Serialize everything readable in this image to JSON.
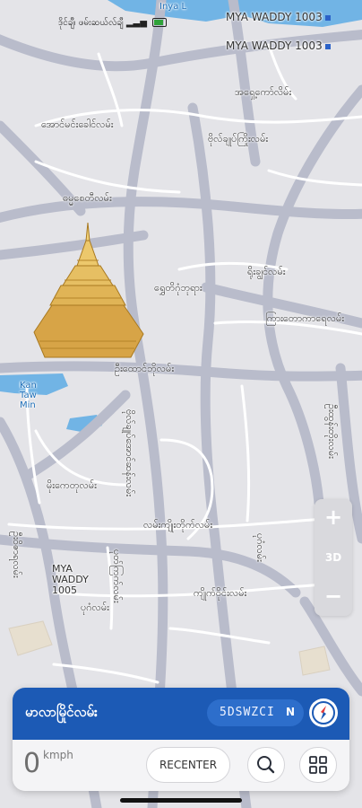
{
  "status_bar": {
    "text": "ဒိုင်ချီ၊ ဖမ်းဆယ်လ်ချီ",
    "battery_level": 0.8
  },
  "map": {
    "labels": {
      "top_water": "Inya L",
      "mya_waddy_top_a": "MYA WADDY 1003",
      "mya_waddy_top_b": "MYA WADDY 1003",
      "road_1": "အရှေ့ကော်လိမ်း",
      "road_2": "အောင်မင်းခေါင်လမ်း",
      "road_3": "ဗိုလ်ချုပ်ကြိုးလမ်း",
      "road_4": "ဓမ္မစေတီလမ်း",
      "road_5": "ရွှေတိဂုံဘုရား",
      "road_6": "ရိုးချွင်လမ်း",
      "road_7": "ကြားတောကာရေလမ်း",
      "road_8": "ဦးထောင်ဘိုလမ်း",
      "water_kan": "Kan\nTaw\nMin",
      "road_9": "မိုးကေတုလမ်း",
      "road_10": "ဗိုလ်ချုပ်အောင်ဆန်းလမ်း",
      "road_11": "ဦးထွန်းတိုးလမ်း",
      "road_12": "လမ်းကျိုးတိုက်လမ်း",
      "road_13": "ဦးဝိဇာရလမ်း",
      "road_14": "ပုတ်ကြက်လမ်း",
      "mya_waddy_mid": "MYA\nWADDY\n1005",
      "road_15": "ပုဂံလမ်း",
      "road_16": "ကျိုက်ဝိုင်းလမ်း",
      "road_17": "ပုဂံလမ်း"
    }
  },
  "map_controls": {
    "zoom_in": "+",
    "tilt": "3D",
    "zoom_out": "−"
  },
  "nav_panel": {
    "street_name": "မာလာမြိုင်လမ်း",
    "location_code": "5DSWZCI",
    "heading": "N",
    "speed_value": "0",
    "speed_unit": "kmph",
    "recenter_label": "RECENTER"
  },
  "icons": {
    "compass": "compass-icon",
    "search": "search-icon",
    "grid": "grid-icon",
    "pagoda": "pagoda-icon"
  },
  "colors": {
    "map_background": "#e4e4e8",
    "major_road": "#b9bccb",
    "water": "#71b4e5",
    "panel_blue": "#1c5ab5",
    "pagoda_gold": "#d9a846"
  }
}
